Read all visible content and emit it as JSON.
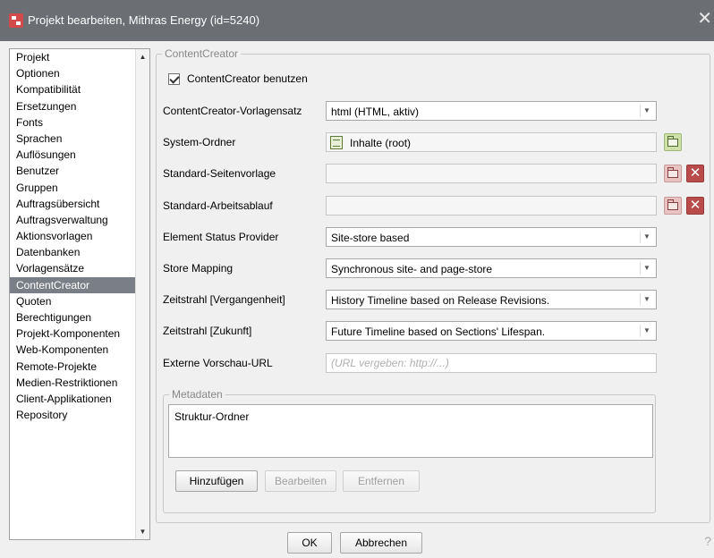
{
  "window": {
    "title": "Projekt bearbeiten, Mithras Energy (id=5240)",
    "close_icon": "close-icon"
  },
  "sidebar": {
    "items": [
      {
        "label": "Projekt",
        "selected": false
      },
      {
        "label": "Optionen",
        "selected": false
      },
      {
        "label": "Kompatibilität",
        "selected": false
      },
      {
        "label": "Ersetzungen",
        "selected": false
      },
      {
        "label": "Fonts",
        "selected": false
      },
      {
        "label": "Sprachen",
        "selected": false
      },
      {
        "label": "Auflösungen",
        "selected": false
      },
      {
        "label": "Benutzer",
        "selected": false
      },
      {
        "label": "Gruppen",
        "selected": false
      },
      {
        "label": "Auftragsübersicht",
        "selected": false
      },
      {
        "label": "Auftragsverwaltung",
        "selected": false
      },
      {
        "label": "Aktionsvorlagen",
        "selected": false
      },
      {
        "label": "Datenbanken",
        "selected": false
      },
      {
        "label": "Vorlagensätze",
        "selected": false
      },
      {
        "label": "ContentCreator",
        "selected": true
      },
      {
        "label": "Quoten",
        "selected": false
      },
      {
        "label": "Berechtigungen",
        "selected": false
      },
      {
        "label": "Projekt-Komponenten",
        "selected": false
      },
      {
        "label": "Web-Komponenten",
        "selected": false
      },
      {
        "label": "Remote-Projekte",
        "selected": false
      },
      {
        "label": "Medien-Restriktionen",
        "selected": false
      },
      {
        "label": "Client-Applikationen",
        "selected": false
      },
      {
        "label": "Repository",
        "selected": false
      }
    ]
  },
  "contentcreator": {
    "group_title": "ContentCreator",
    "use_checkbox": {
      "label": "ContentCreator benutzen",
      "checked": true
    },
    "vorlagensatz": {
      "label": "ContentCreator-Vorlagensatz",
      "value": "html (HTML, aktiv)"
    },
    "system_ordner": {
      "label": "System-Ordner",
      "value": "Inhalte (root)"
    },
    "seitenvorlage": {
      "label": "Standard-Seitenvorlage",
      "value": ""
    },
    "arbeitsablauf": {
      "label": "Standard-Arbeitsablauf",
      "value": ""
    },
    "status_provider": {
      "label": "Element Status Provider",
      "value": "Site-store based"
    },
    "store_mapping": {
      "label": "Store Mapping",
      "value": "Synchronous site- and page-store"
    },
    "zeitstrahl_past": {
      "label": "Zeitstrahl [Vergangenheit]",
      "value": "History Timeline based on Release Revisions."
    },
    "zeitstrahl_future": {
      "label": "Zeitstrahl [Zukunft]",
      "value": "Future Timeline based on Sections' Lifespan."
    },
    "vorschau_url": {
      "label": "Externe Vorschau-URL",
      "placeholder": "(URL vergeben: http://...)"
    }
  },
  "metadaten": {
    "title": "Metadaten",
    "items": [
      "Struktur-Ordner"
    ],
    "add_label": "Hinzufügen",
    "edit_label": "Bearbeiten",
    "remove_label": "Entfernen"
  },
  "footer": {
    "ok_label": "OK",
    "cancel_label": "Abbrechen",
    "help_label": "?"
  },
  "colors": {
    "titlebar": "#6b6f74",
    "selected_nav": "#7a7f87",
    "delete_button": "#b94b4b",
    "folder_button": "#cfe0a8"
  }
}
